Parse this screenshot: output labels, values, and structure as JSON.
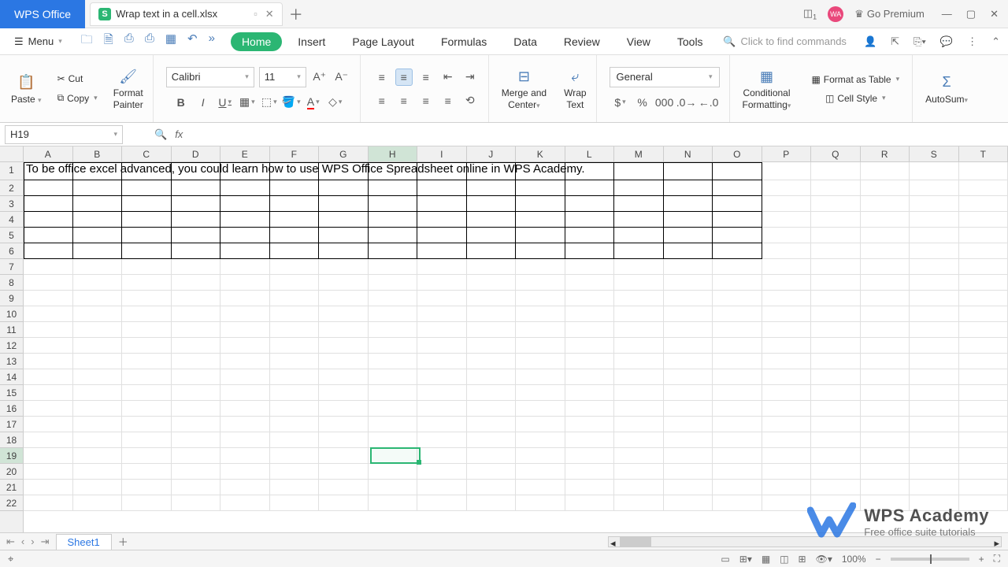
{
  "app": {
    "logo": "WPS Office",
    "filename": "Wrap text in a cell.xlsx"
  },
  "titlebar": {
    "premium": "Go Premium",
    "avatar": "WA"
  },
  "menu": {
    "label": "Menu",
    "tabs": [
      "Home",
      "Insert",
      "Page Layout",
      "Formulas",
      "Data",
      "Review",
      "View",
      "Tools"
    ],
    "search_placeholder": "Click to find commands"
  },
  "ribbon": {
    "paste": "Paste",
    "cut": "Cut",
    "copy": "Copy",
    "format_painter": "Format\nPainter",
    "font": "Calibri",
    "font_size": "11",
    "merge": "Merge and\nCenter",
    "wrap": "Wrap\nText",
    "number_format": "General",
    "cond_fmt": "Conditional\nFormatting",
    "fmt_table": "Format as Table",
    "cell_style": "Cell Style",
    "autosum": "AutoSum"
  },
  "namebox": "H19",
  "columns": [
    "A",
    "B",
    "C",
    "D",
    "E",
    "F",
    "G",
    "H",
    "I",
    "J",
    "K",
    "L",
    "M",
    "N",
    "O",
    "P",
    "Q",
    "R",
    "S",
    "T"
  ],
  "rows": [
    1,
    2,
    3,
    4,
    5,
    6,
    7,
    8,
    9,
    10,
    11,
    12,
    13,
    14,
    15,
    16,
    17,
    18,
    19,
    20,
    21,
    22
  ],
  "cells": {
    "A1": "To be office excel advanced, you could learn how to use WPS Office Spreadsheet online in WPS Academy."
  },
  "selection": {
    "col": "H",
    "row": 19,
    "col_index": 7,
    "row_index": 18
  },
  "sheets": [
    "Sheet1"
  ],
  "status": {
    "zoom": "100%"
  },
  "watermark": {
    "title": "WPS Academy",
    "subtitle": "Free office suite tutorials"
  }
}
